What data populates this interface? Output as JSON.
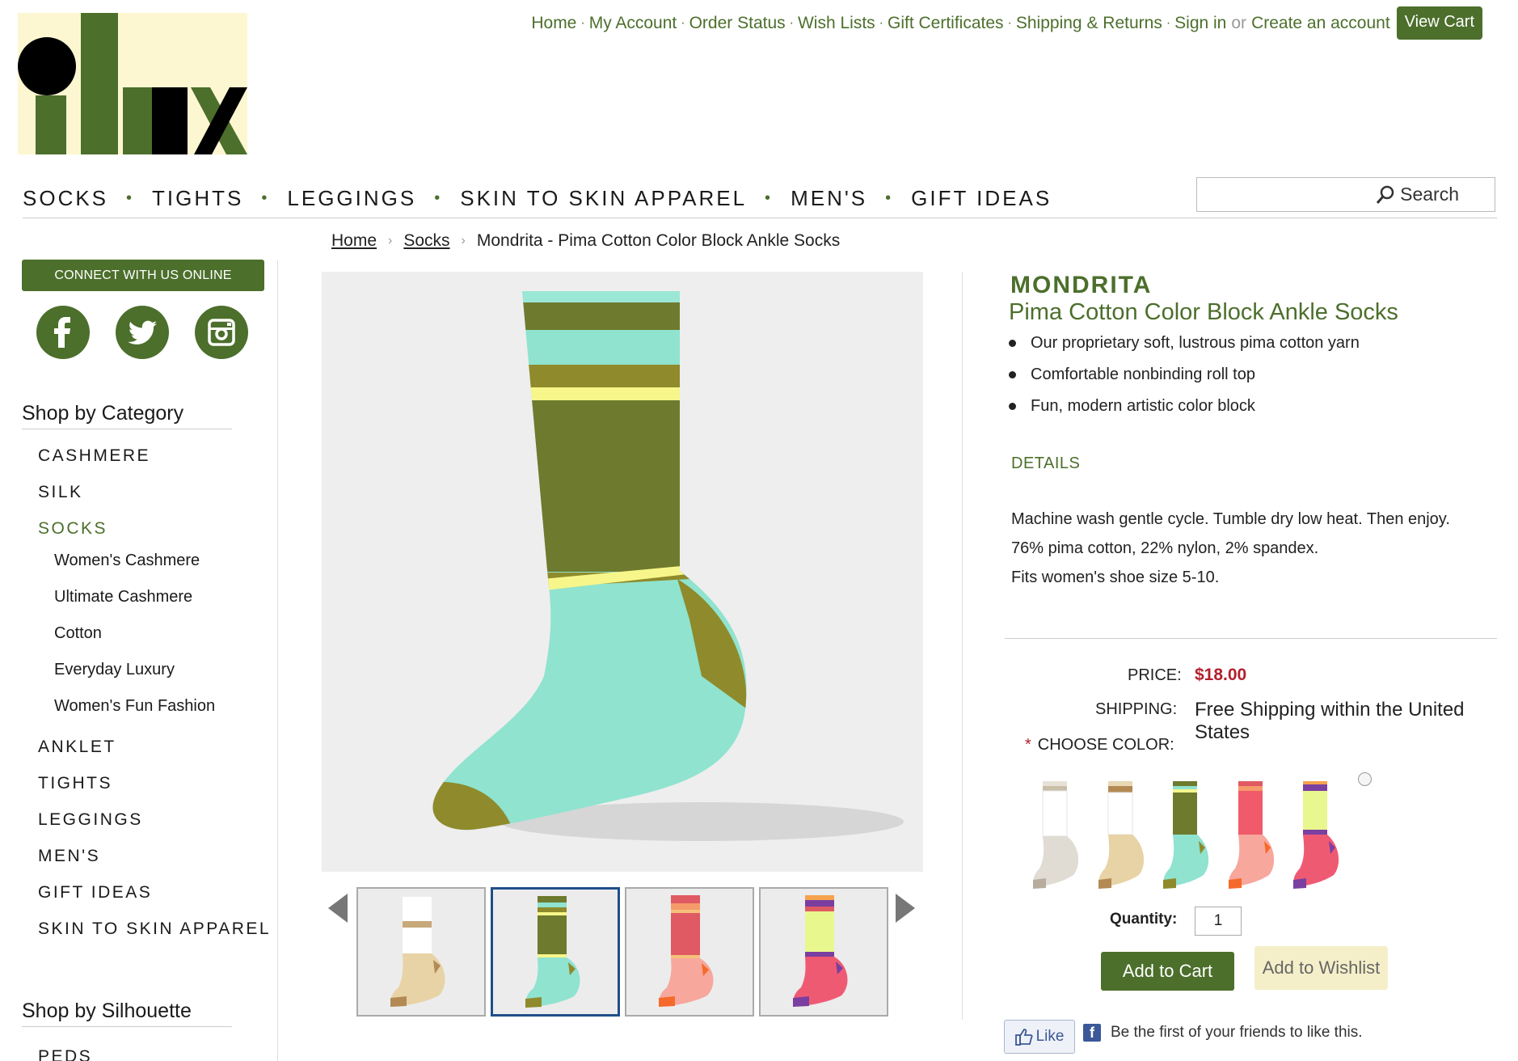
{
  "brand": {
    "logo_text": "ilux"
  },
  "top_links": {
    "items": [
      "Home",
      "My Account",
      "Order Status",
      "Wish Lists",
      "Gift Certificates",
      "Shipping & Returns",
      "Sign in"
    ],
    "or": "or",
    "create_account": "Create an account",
    "view_cart": "View Cart"
  },
  "nav": {
    "items": [
      "SOCKS",
      "TIGHTS",
      "LEGGINGS",
      "SKIN TO SKIN APPAREL",
      "MEN'S",
      "GIFT IDEAS"
    ]
  },
  "search": {
    "label": "Search"
  },
  "breadcrumb": {
    "home": "Home",
    "socks": "Socks",
    "current": "Mondrita - Pima Cotton Color Block Ankle Socks"
  },
  "sidebar": {
    "connect_label": "CONNECT WITH US ONLINE",
    "social": [
      "facebook",
      "twitter",
      "instagram"
    ],
    "category_heading": "Shop by Category",
    "categories": [
      "CASHMERE",
      "SILK",
      "SOCKS"
    ],
    "sock_subcategories": [
      "Women's Cashmere",
      "Ultimate Cashmere",
      "Cotton",
      "Everyday Luxury",
      "Women's Fun Fashion"
    ],
    "more_categories": [
      "ANKLET",
      "TIGHTS",
      "LEGGINGS",
      "MEN'S",
      "GIFT IDEAS",
      "SKIN TO SKIN APPAREL"
    ],
    "silhouette_heading": "Shop by Silhouette",
    "silhouettes": [
      "PEDS"
    ]
  },
  "product": {
    "brand": "MONDRITA",
    "name": "Pima Cotton Color Block Ankle Socks",
    "features": [
      "Our proprietary soft, lustrous pima cotton yarn",
      "Comfortable nonbinding roll top",
      "Fun, modern artistic color block"
    ],
    "details_heading": "DETAILS",
    "details": [
      "Machine wash gentle cycle. Tumble dry low heat. Then enjoy.",
      "76% pima cotton, 22% nylon, 2% spandex.",
      "Fits women's shoe size 5-10."
    ],
    "price_label": "PRICE:",
    "price": "$18.00",
    "shipping_label": "SHIPPING:",
    "shipping": "Free Shipping within the United States",
    "choose_color_required": "*",
    "choose_color_label": "CHOOSE COLOR:",
    "quantity_label": "Quantity:",
    "quantity": "1",
    "add_to_cart": "Add to Cart",
    "add_to_wishlist": "Add to Wishlist"
  },
  "facebook": {
    "like": "Like",
    "text": "Be the first of your friends to like this."
  },
  "colors": {
    "brand_green": "#4c6f2c",
    "price_red": "#b21f2d",
    "selected_thumb": "#1f4f8a",
    "mint": "#8fe3cf",
    "olive": "#6e7a2e",
    "mustard": "#8f8a2b",
    "yellow": "#f6f68a"
  }
}
